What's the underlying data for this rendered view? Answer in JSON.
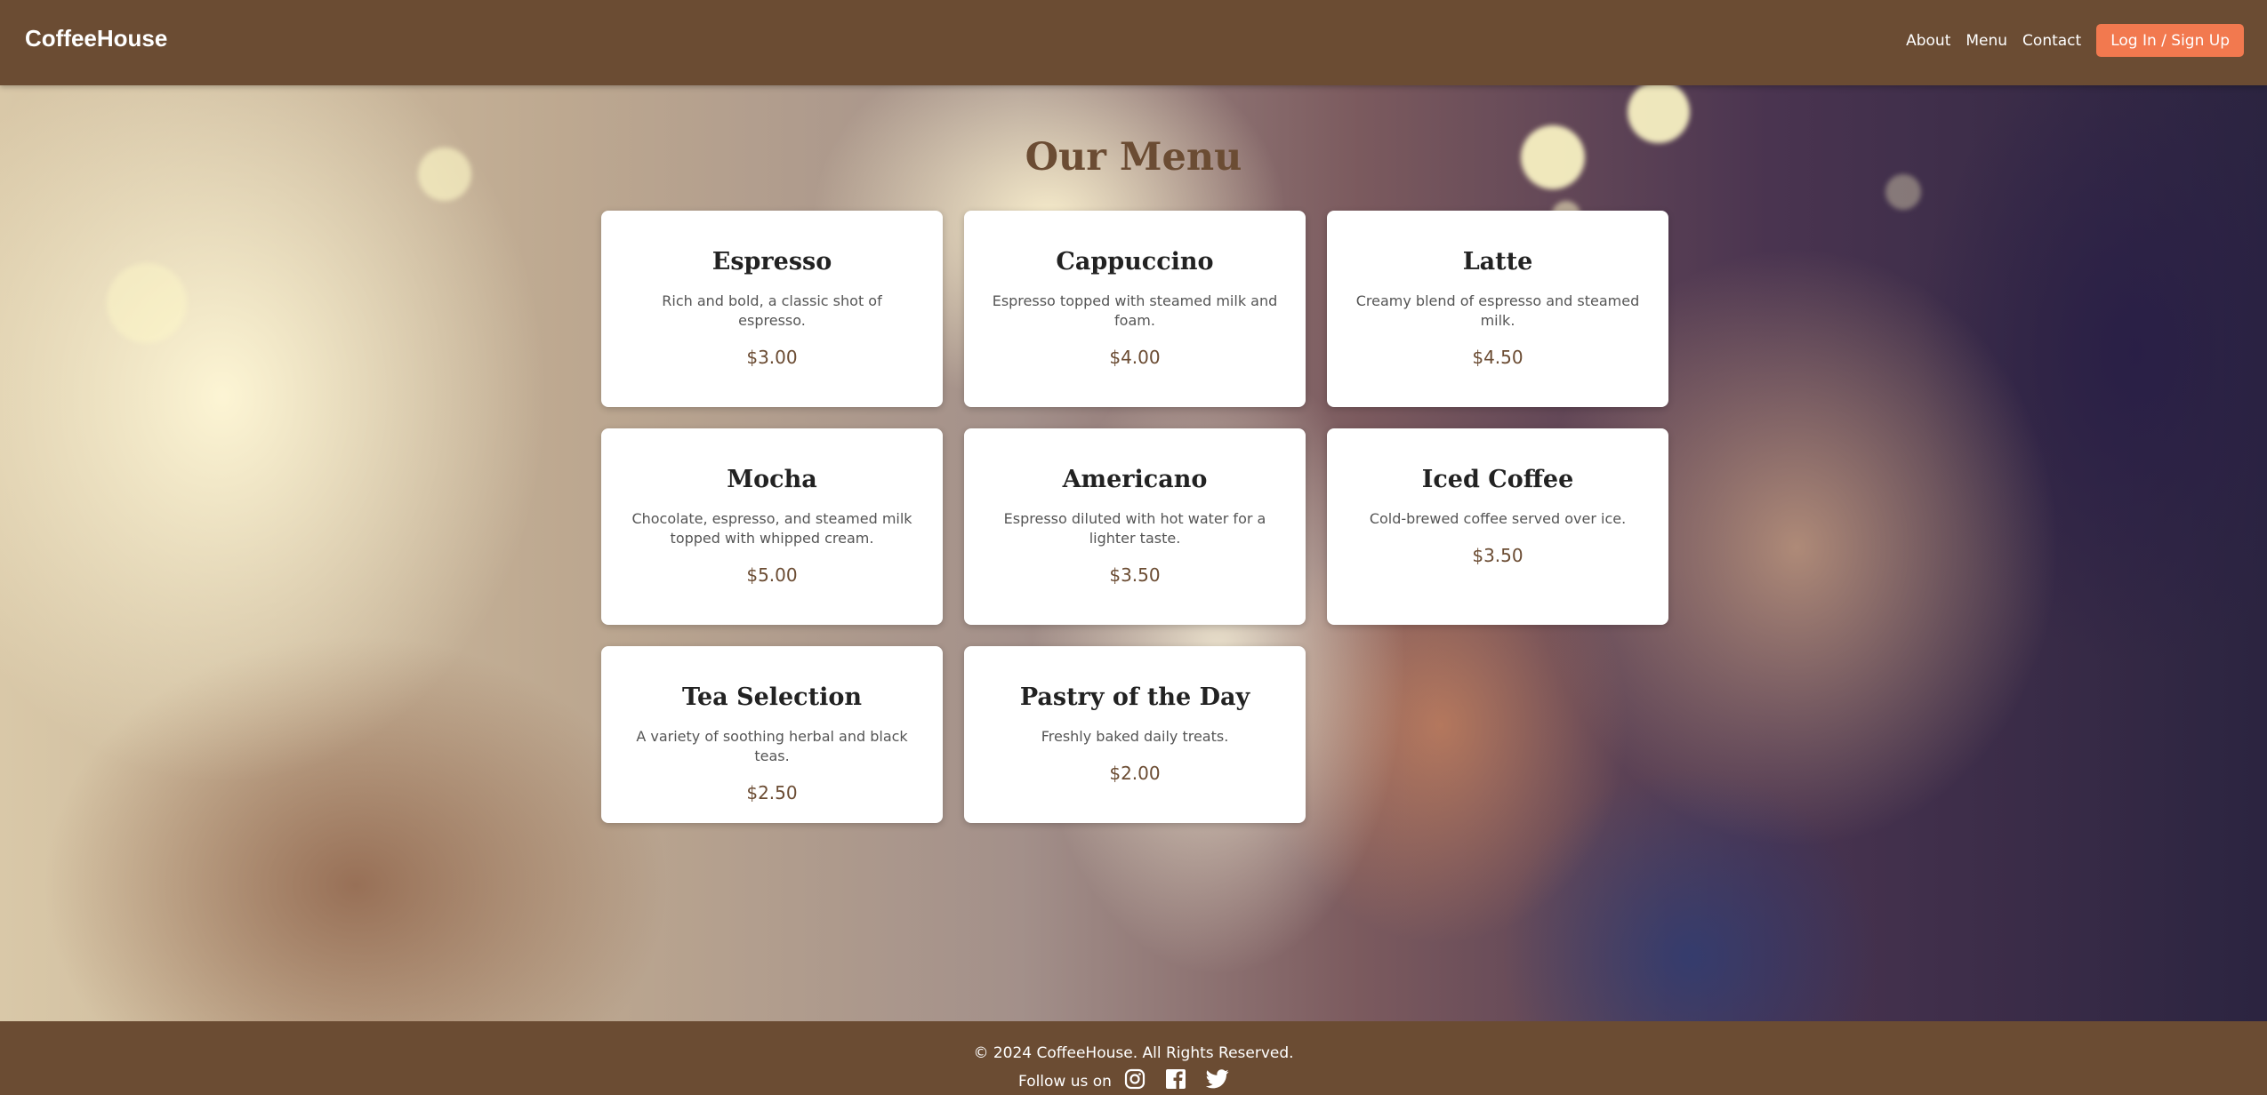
{
  "header": {
    "brand": "CoffeeHouse",
    "nav": [
      "About",
      "Menu",
      "Contact"
    ],
    "login_label": "Log In / Sign Up"
  },
  "main": {
    "title": "Our Menu",
    "items": [
      {
        "name": "Espresso",
        "description": "Rich and bold, a classic shot of espresso.",
        "price": "$3.00"
      },
      {
        "name": "Cappuccino",
        "description": "Espresso topped with steamed milk and foam.",
        "price": "$4.00"
      },
      {
        "name": "Latte",
        "description": "Creamy blend of espresso and steamed milk.",
        "price": "$4.50"
      },
      {
        "name": "Mocha",
        "description": "Chocolate, espresso, and steamed milk topped with whipped cream.",
        "price": "$5.00"
      },
      {
        "name": "Americano",
        "description": "Espresso diluted with hot water for a lighter taste.",
        "price": "$3.50"
      },
      {
        "name": "Iced Coffee",
        "description": "Cold-brewed coffee served over ice.",
        "price": "$3.50"
      },
      {
        "name": "Tea Selection",
        "description": "A variety of soothing herbal and black teas.",
        "price": "$2.50"
      },
      {
        "name": "Pastry of the Day",
        "description": "Freshly baked daily treats.",
        "price": "$2.00"
      }
    ]
  },
  "footer": {
    "copyright": "© 2024 CoffeeHouse. All Rights Reserved.",
    "follow_label": "Follow us on",
    "social_icons": [
      "instagram-icon",
      "facebook-icon",
      "twitter-icon"
    ]
  },
  "colors": {
    "header_bg": "#6b4c33",
    "accent_button": "#f2794f",
    "title": "#6b4c33"
  }
}
